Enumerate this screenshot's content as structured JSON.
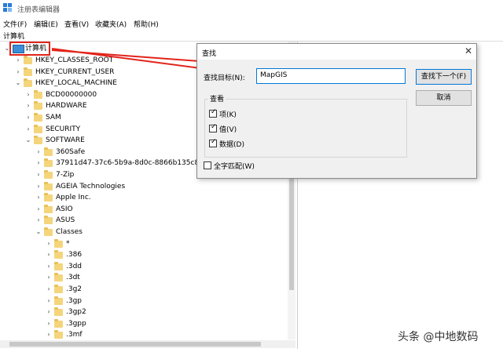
{
  "window": {
    "title": "注册表编辑器"
  },
  "menu": [
    {
      "label": "文件(F)"
    },
    {
      "label": "编辑(E)"
    },
    {
      "label": "查看(V)"
    },
    {
      "label": "收藏夹(A)"
    },
    {
      "label": "帮助(H)"
    }
  ],
  "address": "计算机",
  "tree": {
    "root": "计算机",
    "items": [
      {
        "label": "HKEY_CLASSES_ROOT",
        "level": 1,
        "expanded": false
      },
      {
        "label": "HKEY_CURRENT_USER",
        "level": 1,
        "expanded": false
      },
      {
        "label": "HKEY_LOCAL_MACHINE",
        "level": 1,
        "expanded": true
      },
      {
        "label": "BCD00000000",
        "level": 2,
        "expanded": false
      },
      {
        "label": "HARDWARE",
        "level": 2,
        "expanded": false
      },
      {
        "label": "SAM",
        "level": 2,
        "expanded": false
      },
      {
        "label": "SECURITY",
        "level": 2,
        "expanded": false
      },
      {
        "label": "SOFTWARE",
        "level": 2,
        "expanded": true
      },
      {
        "label": "360Safe",
        "level": 3,
        "expanded": false
      },
      {
        "label": "37911d47-37c6-5b9a-8d0c-8866b135c8a2",
        "level": 3,
        "expanded": false
      },
      {
        "label": "7-Zip",
        "level": 3,
        "expanded": false
      },
      {
        "label": "AGEIA Technologies",
        "level": 3,
        "expanded": false
      },
      {
        "label": "Apple Inc.",
        "level": 3,
        "expanded": false
      },
      {
        "label": "ASIO",
        "level": 3,
        "expanded": false
      },
      {
        "label": "ASUS",
        "level": 3,
        "expanded": false
      },
      {
        "label": "Classes",
        "level": 3,
        "expanded": true
      },
      {
        "label": "*",
        "level": 4,
        "expanded": false
      },
      {
        "label": ".386",
        "level": 4,
        "expanded": false
      },
      {
        "label": ".3dd",
        "level": 4,
        "expanded": false
      },
      {
        "label": ".3dt",
        "level": 4,
        "expanded": false
      },
      {
        "label": ".3g2",
        "level": 4,
        "expanded": false
      },
      {
        "label": ".3gp",
        "level": 4,
        "expanded": false
      },
      {
        "label": ".3gp2",
        "level": 4,
        "expanded": false
      },
      {
        "label": ".3gpp",
        "level": 4,
        "expanded": false
      },
      {
        "label": ".3mf",
        "level": 4,
        "expanded": false
      }
    ]
  },
  "find_dialog": {
    "title": "查找",
    "find_label": "查找目标(N):",
    "find_value": "MapGIS",
    "find_next_button": "查找下一个(F)",
    "cancel_button": "取消",
    "look_at_label": "查看",
    "options": [
      {
        "label": "项(K)",
        "checked": true
      },
      {
        "label": "值(V)",
        "checked": true
      },
      {
        "label": "数据(D)",
        "checked": true
      }
    ],
    "match_whole": {
      "label": "全字匹配(W)",
      "checked": false
    }
  },
  "watermark": "头条 @中地数码",
  "colors": {
    "highlight": "#e2231a",
    "accent": "#0078d7",
    "folder": "#f4d57b"
  }
}
